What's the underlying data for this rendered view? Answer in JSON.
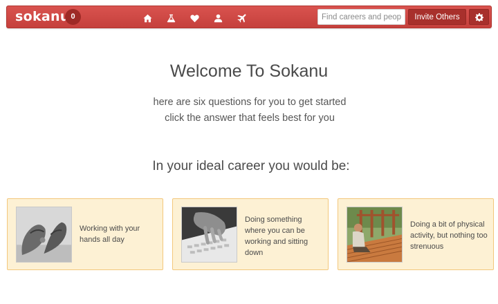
{
  "header": {
    "logo": "sokanu",
    "badge_count": "0",
    "nav_icons": [
      "home-icon",
      "flask-icon",
      "heart-icon",
      "user-icon",
      "plane-icon"
    ],
    "search_placeholder": "Find careers and people",
    "invite_label": "Invite Others",
    "settings_icon": "gear-icon",
    "accent_color": "#d04a45"
  },
  "main": {
    "title": "Welcome To Sokanu",
    "subtitle_line1": "here are six questions for you to get started",
    "subtitle_line2": "click the answer that feels best for you",
    "question": "In your ideal career you would be:",
    "answers": [
      {
        "text": "Working with your hands all day",
        "image": "hands-photo"
      },
      {
        "text": "Doing something where you can be working and sitting down",
        "image": "typing-photo"
      },
      {
        "text": "Doing a bit of physical activity, but nothing too strenuous",
        "image": "carpentry-photo"
      }
    ]
  }
}
